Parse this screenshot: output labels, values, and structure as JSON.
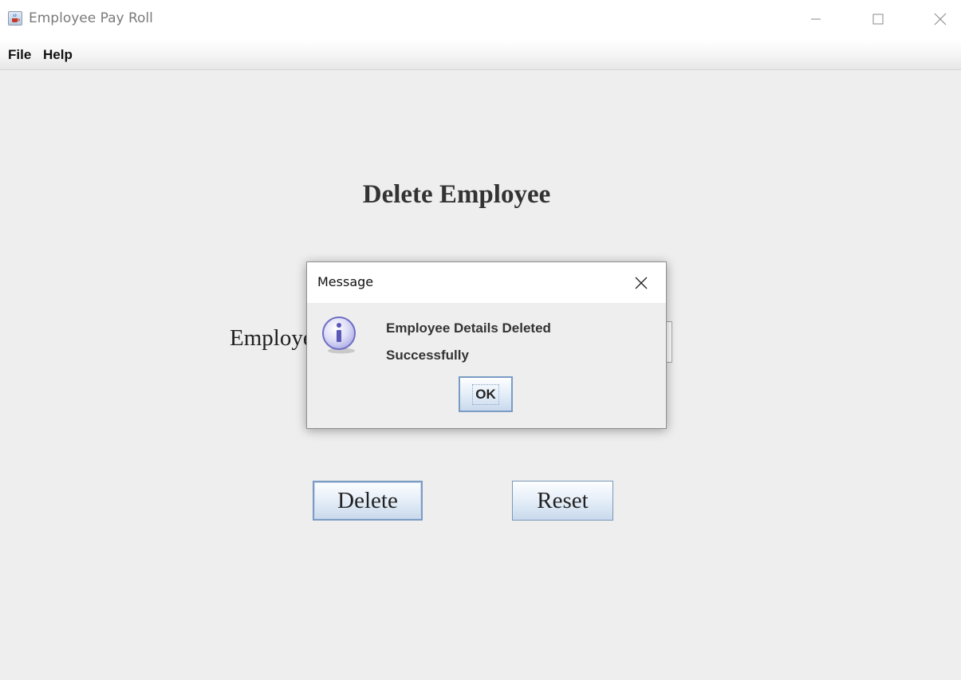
{
  "window": {
    "title": "Employee Pay Roll"
  },
  "menubar": {
    "items": [
      {
        "label": "File"
      },
      {
        "label": "Help"
      }
    ]
  },
  "form": {
    "heading": "Delete Employee",
    "employee_id_label": "Employee ID",
    "employee_id_value": "",
    "delete_label": "Delete",
    "reset_label": "Reset"
  },
  "dialog": {
    "title": "Message",
    "message_line1": "Employee Details Deleted",
    "message_line2": "Successfully",
    "ok_label": "OK",
    "icon": "info-icon"
  },
  "icons": {
    "app": "java-cup-icon",
    "minimize": "minimize-icon",
    "maximize": "maximize-icon",
    "close": "close-icon",
    "dialog_close": "close-icon",
    "dialog_info": "info-icon"
  },
  "colors": {
    "window_bg": "#eeeeee",
    "button_border": "#7a9cc4",
    "info_icon": "#8f8ed8"
  }
}
